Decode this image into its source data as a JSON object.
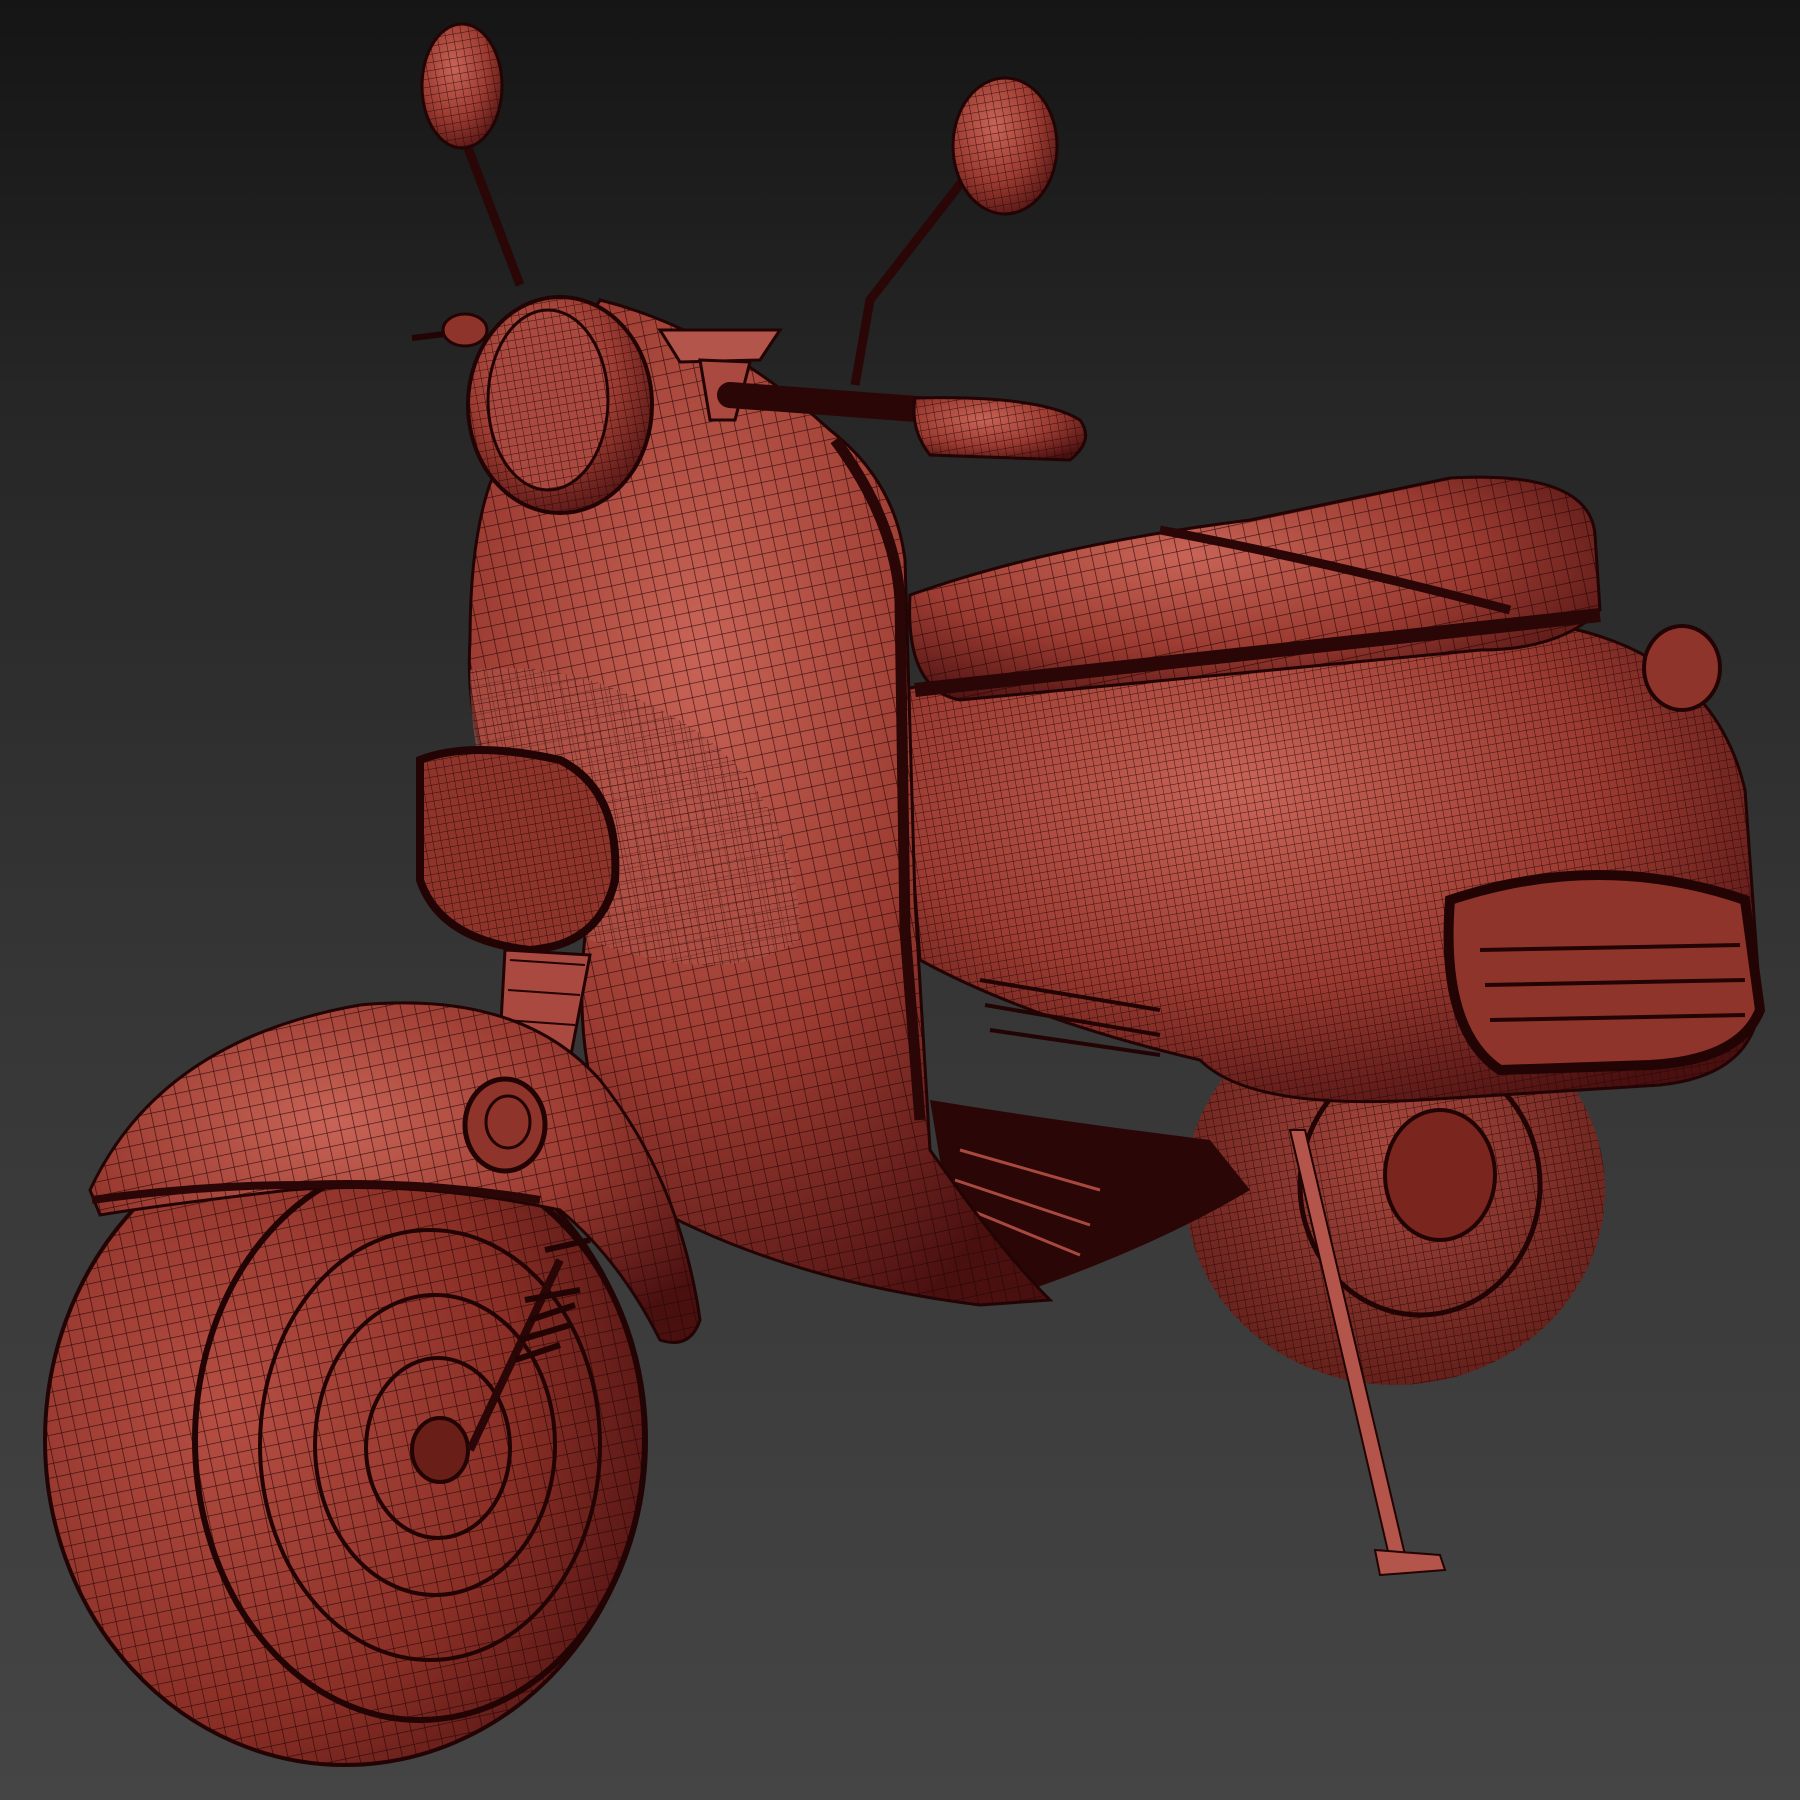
{
  "viewport": {
    "shading_mode": "edged-faces",
    "background_gradient": [
      "#151515",
      "#454545"
    ]
  },
  "model": {
    "subject": "scooter",
    "material_color": "#9b3b31",
    "highlight_color": "#c86457",
    "shadow_color": "#4a1010",
    "wire_color": "#220404"
  }
}
